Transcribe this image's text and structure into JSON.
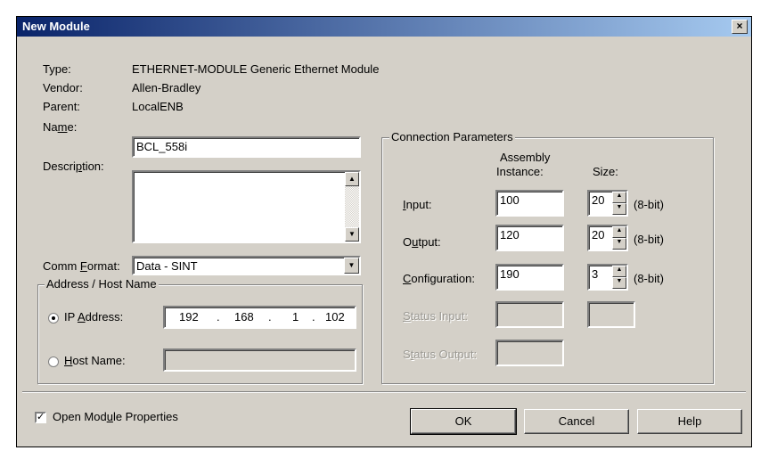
{
  "window": {
    "title": "New Module",
    "close": "×"
  },
  "info": {
    "type_label": "Type:",
    "type_value": "ETHERNET-MODULE Generic Ethernet Module",
    "vendor_label": "Vendor:",
    "vendor_value": "Allen-Bradley",
    "parent_label": "Parent:",
    "parent_value": "LocalENB"
  },
  "name": {
    "label_pre": "Na",
    "label_u": "m",
    "label_post": "e:",
    "value": "BCL_558i"
  },
  "description": {
    "label_pre": "Descri",
    "label_u": "p",
    "label_post": "tion:",
    "value": ""
  },
  "comm_format": {
    "label_pre": "Comm ",
    "label_u": "F",
    "label_post": "ormat:",
    "value": "Data - SINT"
  },
  "address": {
    "group_title": "Address / Host Name",
    "ip_label_pre": "IP ",
    "ip_label_u": "A",
    "ip_label_post": "ddress:",
    "ip_octets": [
      "192",
      "168",
      "1",
      "102"
    ],
    "ip_dot": ".",
    "host_label_pre": "",
    "host_label_u": "H",
    "host_label_post": "ost Name:",
    "host_value": "",
    "selected": "ip"
  },
  "connection": {
    "group_title": "Connection Parameters",
    "col_assembly": "Assembly",
    "col_instance": "Instance:",
    "col_size": "Size:",
    "unit": "(8-bit)",
    "rows": [
      {
        "label_pre": "",
        "label_u": "I",
        "label_post": "nput:",
        "instance": "100",
        "size": "20"
      },
      {
        "label_pre": "O",
        "label_u": "u",
        "label_post": "tput:",
        "instance": "120",
        "size": "20"
      },
      {
        "label_pre": "",
        "label_u": "C",
        "label_post": "onfiguration:",
        "instance": "190",
        "size": "3"
      }
    ],
    "status_input": {
      "label_pre": "",
      "label_u": "S",
      "label_post": "tatus Input:"
    },
    "status_output": {
      "label_pre": "S",
      "label_u": "t",
      "label_post": "atus Output:"
    }
  },
  "open_props": {
    "label_pre": "Open Mod",
    "label_u": "u",
    "label_post": "le Properties",
    "checked": true
  },
  "buttons": {
    "ok": "OK",
    "cancel": "Cancel",
    "help": "Help"
  }
}
